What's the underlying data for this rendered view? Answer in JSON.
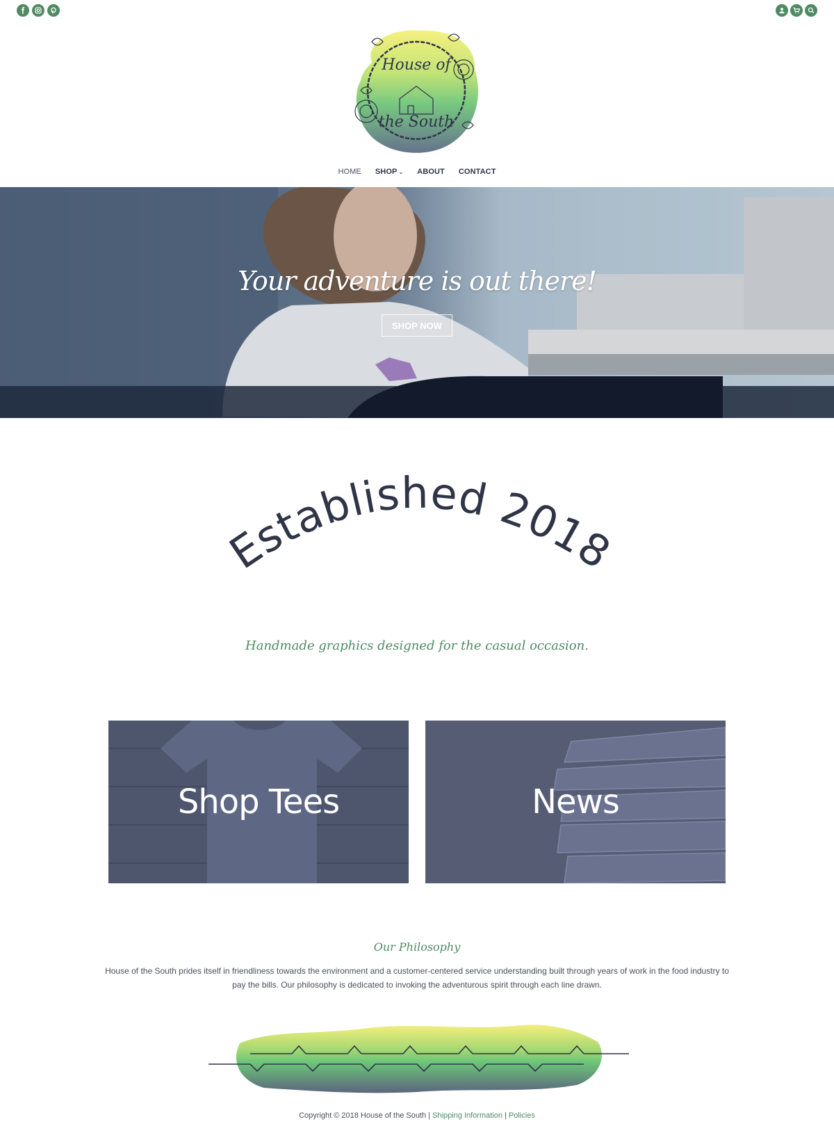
{
  "social_icons": [
    "facebook-icon",
    "instagram-icon",
    "pinterest-icon"
  ],
  "util_icons": [
    "account-icon",
    "cart-icon",
    "search-icon"
  ],
  "brand": {
    "logo_line1": "House of",
    "logo_line2": "the South"
  },
  "nav": {
    "home": "HOME",
    "shop": "SHOP",
    "about": "ABOUT",
    "contact": "CONTACT"
  },
  "hero": {
    "title": "Your adventure is out there!",
    "button": "SHOP NOW"
  },
  "established": "Established 2018",
  "tagline": "Handmade graphics designed for the casual occasion.",
  "tiles": {
    "shop": "Shop Tees",
    "news": "News"
  },
  "philosophy": {
    "title": "Our Philosophy",
    "text": "House of the South prides itself in friendliness towards the environment and a customer-centered service understanding built through years of work in the food industry to pay the bills. Our philosophy is dedicated to invoking the adventurous spirit through each line drawn."
  },
  "footer": {
    "copyright": "Copyright © 2018 House of the South | ",
    "shipping": "Shipping Information",
    "sep": " | ",
    "policies": "Policies"
  },
  "colors": {
    "accent_green": "#4f8a63",
    "navy": "#2f3447",
    "overlay": "#4a5470"
  }
}
